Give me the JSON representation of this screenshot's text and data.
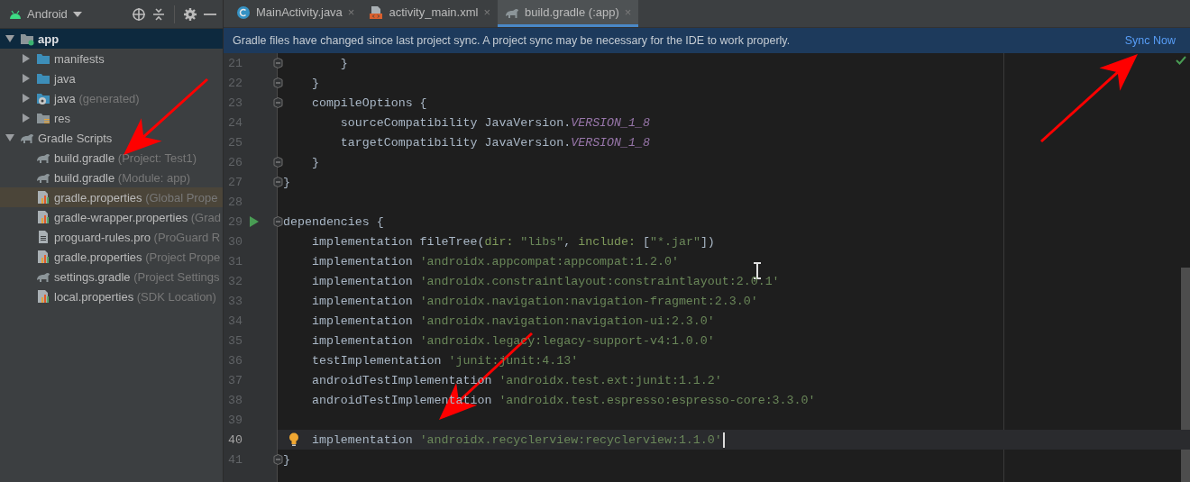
{
  "project_view": {
    "view": "Android"
  },
  "tree": [
    {
      "label": "app",
      "kind": "module",
      "expanded": true,
      "selected": true,
      "highlighted": false,
      "children": [
        {
          "label": "manifests",
          "kind": "folder",
          "expanded": false,
          "selected": false,
          "highlighted": false
        },
        {
          "label": "java",
          "kind": "folder",
          "expanded": false,
          "selected": false,
          "highlighted": false
        },
        {
          "label": "java",
          "detail": "(generated)",
          "kind": "folder-generated",
          "expanded": false,
          "selected": false,
          "highlighted": false
        },
        {
          "label": "res",
          "kind": "folder-res",
          "expanded": false,
          "selected": false,
          "highlighted": false
        }
      ]
    },
    {
      "label": "Gradle Scripts",
      "kind": "gradle",
      "expanded": true,
      "selected": false,
      "highlighted": false,
      "children": [
        {
          "label": "build.gradle",
          "detail": "(Project: Test1)",
          "kind": "gradle",
          "selected": false,
          "highlighted": false
        },
        {
          "label": "build.gradle",
          "detail": "(Module: app)",
          "kind": "gradle",
          "selected": false,
          "highlighted": false
        },
        {
          "label": "gradle.properties",
          "detail": "(Global Prope",
          "kind": "properties",
          "selected": false,
          "highlighted": true
        },
        {
          "label": "gradle-wrapper.properties",
          "detail": "(Grad",
          "kind": "properties",
          "selected": false,
          "highlighted": false
        },
        {
          "label": "proguard-rules.pro",
          "detail": "(ProGuard R",
          "kind": "file",
          "selected": false,
          "highlighted": false
        },
        {
          "label": "gradle.properties",
          "detail": "(Project Prope",
          "kind": "properties",
          "selected": false,
          "highlighted": false
        },
        {
          "label": "settings.gradle",
          "detail": "(Project Settings",
          "kind": "gradle",
          "selected": false,
          "highlighted": false
        },
        {
          "label": "local.properties",
          "detail": "(SDK Location)",
          "kind": "properties",
          "selected": false,
          "highlighted": false
        }
      ]
    }
  ],
  "tabs": [
    {
      "label": "MainActivity.java",
      "kind": "java-class",
      "close": "×",
      "selected": false
    },
    {
      "label": "activity_main.xml",
      "kind": "xml",
      "close": "×",
      "selected": false
    },
    {
      "label": "build.gradle (:app)",
      "kind": "gradle",
      "close": "×",
      "selected": true
    }
  ],
  "banner": {
    "message": "Gradle files have changed since last project sync. A project sync may be necessary for the IDE to work properly.",
    "action": "Sync Now"
  },
  "code_lines": [
    {
      "number": "21",
      "fold": true,
      "run": false,
      "bulb": false,
      "current": false,
      "tokens": [
        {
          "text": "        }",
          "kind": "plain"
        }
      ]
    },
    {
      "number": "22",
      "fold": true,
      "run": false,
      "bulb": false,
      "current": false,
      "tokens": [
        {
          "text": "    }",
          "kind": "plain"
        }
      ]
    },
    {
      "number": "23",
      "fold": true,
      "run": false,
      "bulb": false,
      "current": false,
      "tokens": [
        {
          "text": "    compileOptions {",
          "kind": "plain"
        }
      ]
    },
    {
      "number": "24",
      "fold": false,
      "run": false,
      "bulb": false,
      "current": false,
      "tokens": [
        {
          "text": "        sourceCompatibility JavaVersion.",
          "kind": "plain"
        },
        {
          "text": "VERSION_1_8",
          "kind": "constant"
        }
      ]
    },
    {
      "number": "25",
      "fold": false,
      "run": false,
      "bulb": false,
      "current": false,
      "tokens": [
        {
          "text": "        targetCompatibility JavaVersion.",
          "kind": "plain"
        },
        {
          "text": "VERSION_1_8",
          "kind": "constant"
        }
      ]
    },
    {
      "number": "26",
      "fold": true,
      "run": false,
      "bulb": false,
      "current": false,
      "tokens": [
        {
          "text": "    }",
          "kind": "plain"
        }
      ]
    },
    {
      "number": "27",
      "fold": true,
      "run": false,
      "bulb": false,
      "current": false,
      "tokens": [
        {
          "text": "}",
          "kind": "plain"
        }
      ]
    },
    {
      "number": "28",
      "fold": false,
      "run": false,
      "bulb": false,
      "current": false
    },
    {
      "number": "29",
      "fold": true,
      "run": true,
      "bulb": false,
      "current": false,
      "tokens": [
        {
          "text": "dependencies {",
          "kind": "plain"
        }
      ]
    },
    {
      "number": "30",
      "fold": false,
      "run": false,
      "bulb": false,
      "current": false,
      "tokens": [
        {
          "text": "    implementation fileTree(",
          "kind": "plain"
        },
        {
          "text": "dir: ",
          "kind": "arg"
        },
        {
          "text": "\"libs\"",
          "kind": "string"
        },
        {
          "text": ", ",
          "kind": "plain"
        },
        {
          "text": "include: ",
          "kind": "arg"
        },
        {
          "text": "[",
          "kind": "plain"
        },
        {
          "text": "\"*.jar\"",
          "kind": "string"
        },
        {
          "text": "])",
          "kind": "plain"
        }
      ]
    },
    {
      "number": "31",
      "fold": false,
      "run": false,
      "bulb": false,
      "current": false,
      "tokens": [
        {
          "text": "    implementation ",
          "kind": "plain"
        },
        {
          "text": "'androidx.appcompat:appcompat:1.2.0'",
          "kind": "string"
        }
      ]
    },
    {
      "number": "32",
      "fold": false,
      "run": false,
      "bulb": false,
      "current": false,
      "tokens": [
        {
          "text": "    implementation ",
          "kind": "plain"
        },
        {
          "text": "'androidx.constraintlayout:constraintlayout:2.0.1'",
          "kind": "string"
        }
      ]
    },
    {
      "number": "33",
      "fold": false,
      "run": false,
      "bulb": false,
      "current": false,
      "tokens": [
        {
          "text": "    implementation ",
          "kind": "plain"
        },
        {
          "text": "'androidx.navigation:navigation-fragment:2.3.0'",
          "kind": "string"
        }
      ]
    },
    {
      "number": "34",
      "fold": false,
      "run": false,
      "bulb": false,
      "current": false,
      "tokens": [
        {
          "text": "    implementation ",
          "kind": "plain"
        },
        {
          "text": "'androidx.navigation:navigation-ui:2.3.0'",
          "kind": "string"
        }
      ]
    },
    {
      "number": "35",
      "fold": false,
      "run": false,
      "bulb": false,
      "current": false,
      "tokens": [
        {
          "text": "    implementation ",
          "kind": "plain"
        },
        {
          "text": "'androidx.legacy:legacy-support-v4:1.0.0'",
          "kind": "string"
        }
      ]
    },
    {
      "number": "36",
      "fold": false,
      "run": false,
      "bulb": false,
      "current": false,
      "tokens": [
        {
          "text": "    testImplementation ",
          "kind": "plain"
        },
        {
          "text": "'junit:junit:4.13'",
          "kind": "string"
        }
      ]
    },
    {
      "number": "37",
      "fold": false,
      "run": false,
      "bulb": false,
      "current": false,
      "tokens": [
        {
          "text": "    androidTestImplementation ",
          "kind": "plain"
        },
        {
          "text": "'androidx.test.ext:junit:1.1.2'",
          "kind": "string"
        }
      ]
    },
    {
      "number": "38",
      "fold": false,
      "run": false,
      "bulb": false,
      "current": false,
      "tokens": [
        {
          "text": "    androidTestImplementation ",
          "kind": "plain"
        },
        {
          "text": "'androidx.test.espresso:espresso-core:3.3.0'",
          "kind": "string"
        }
      ]
    },
    {
      "number": "39",
      "fold": false,
      "run": false,
      "bulb": false,
      "current": false
    },
    {
      "number": "40",
      "fold": false,
      "run": false,
      "bulb": true,
      "current": true,
      "tokens": [
        {
          "text": "    implementation ",
          "kind": "plain"
        },
        {
          "text": "'androidx.recyclerview:recyclerview:1.1.0'",
          "kind": "string"
        }
      ]
    },
    {
      "number": "41",
      "fold": true,
      "run": false,
      "bulb": false,
      "current": false,
      "tokens": [
        {
          "text": "}",
          "kind": "plain"
        }
      ]
    }
  ]
}
